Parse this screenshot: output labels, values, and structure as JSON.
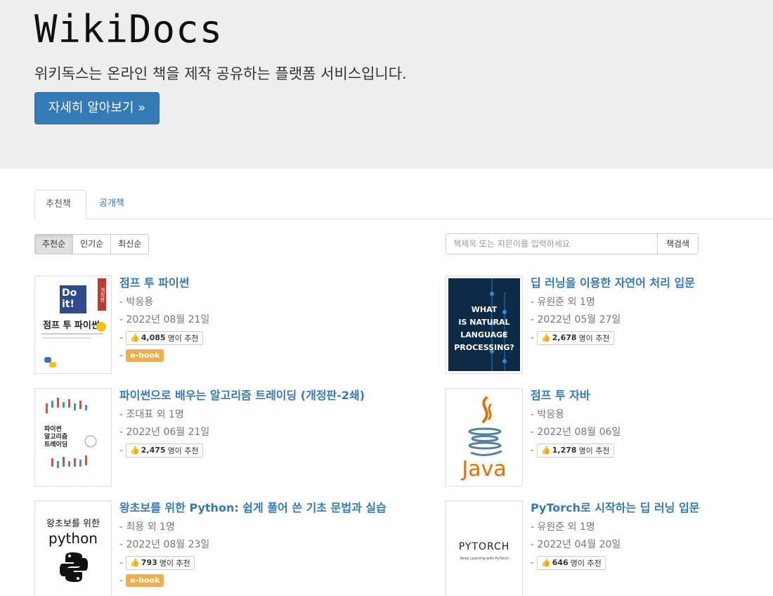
{
  "header": {
    "site_title": "WikiDocs",
    "tagline": "위키독스는 온라인 책을 제작 공유하는 플랫폼 서비스입니다.",
    "learn_more_label": "자세히 알아보기 »"
  },
  "tabs": [
    {
      "label": "추천책",
      "active": true
    },
    {
      "label": "공개책",
      "active": false
    }
  ],
  "sort_buttons": [
    "추천순",
    "인기순",
    "최신순"
  ],
  "search": {
    "placeholder": "책제목 또는 지은이를 입력하세요",
    "button_label": "책검색"
  },
  "recommend_suffix": "명이 추천",
  "books": [
    {
      "title": "점프 투 파이썬",
      "author": "- 박응용",
      "date": "- 2022년 08월 21일",
      "recommendations": "4,085",
      "ebook": "e-book",
      "cover": {
        "line1": "Do",
        "line2": "it!",
        "ribbon": "개정판",
        "title": "점프 투 파이썬"
      }
    },
    {
      "title": "딥 러닝을 이용한 자연어 처리 입문",
      "author": "- 유원준 외 1명",
      "date": "- 2022년 05월 27일",
      "recommendations": "2,678",
      "ebook": "",
      "cover": {
        "lines": [
          "WHAT",
          "IS NATURAL",
          "LANGUAGE",
          "PROCESSING?"
        ]
      }
    },
    {
      "title": "파이썬으로 배우는 알고리즘 트레이딩 (개정판-2쇄)",
      "author": "- 조대표 외 1명",
      "date": "- 2022년 06월 21일",
      "recommendations": "2,475",
      "ebook": "",
      "cover": {
        "line1": "파이썬",
        "line2": "알고리즘",
        "line3": "트레이딩"
      }
    },
    {
      "title": "점프 투 자바",
      "author": "- 박응용",
      "date": "- 2022년 08월 06일",
      "recommendations": "1,278",
      "ebook": "",
      "cover": {
        "word": "Java"
      }
    },
    {
      "title": "왕초보를 위한 Python: 쉽게 풀어 쓴 기초 문법과 실습",
      "author": "- 최용 외 1명",
      "date": "- 2022년 08월 23일",
      "recommendations": "793",
      "ebook": "e-book",
      "cover": {
        "line1": "왕초보를 위한",
        "line2": "python"
      }
    },
    {
      "title": "PyTorch로 시작하는 딥 러닝 입문",
      "author": "- 유원준 외 1명",
      "date": "- 2022년 04월 20일",
      "recommendations": "646",
      "ebook": "",
      "cover": {
        "word": "PYTORCH",
        "sub": "Deep Learning with PyTorch"
      }
    }
  ],
  "colors": {
    "primary": "#337ab7",
    "ebook_badge": "#f0ad4e",
    "jumbotron_bg": "#eeeeee"
  }
}
